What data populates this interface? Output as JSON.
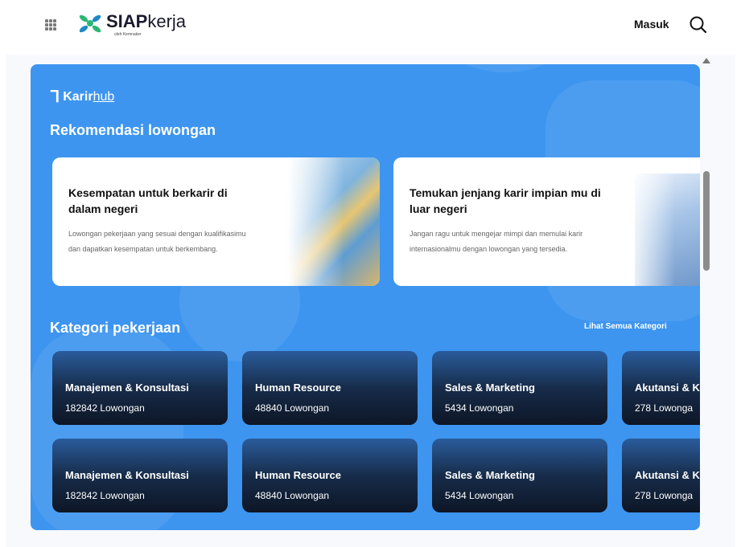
{
  "header": {
    "logo_bold": "SIAP",
    "logo_light": "kerja",
    "logo_sub": "oleh Kemnaker",
    "login_label": "Masuk",
    "search_icon": "search-icon",
    "apps_icon": "grid-icon"
  },
  "brand": {
    "bold": "Karir",
    "underline": "hub"
  },
  "recommendations": {
    "title": "Rekomendasi lowongan",
    "cards": [
      {
        "title": "Kesempatan untuk berkarir di dalam negeri",
        "desc": "Lowongan pekerjaan yang sesuai dengan kualifikasimu dan dapatkan kesempatan untuk berkembang."
      },
      {
        "title": "Temukan jenjang karir impian mu di luar negeri",
        "desc": "Jangan ragu untuk mengejar mimpi dan memulai karir internasionalmu dengan lowongan yang tersedia."
      }
    ]
  },
  "categories": {
    "title": "Kategori pekerjaan",
    "see_all": "Lihat Semua Kategori",
    "rows": [
      [
        {
          "name": "Manajemen & Konsultasi",
          "count": "182842 Lowongan"
        },
        {
          "name": "Human Resource",
          "count": "48840 Lowongan"
        },
        {
          "name": "Sales & Marketing",
          "count": "5434 Lowongan"
        },
        {
          "name": "Akutansi & K",
          "count": "278 Lowonga"
        }
      ],
      [
        {
          "name": "Manajemen & Konsultasi",
          "count": "182842 Lowongan"
        },
        {
          "name": "Human Resource",
          "count": "48840 Lowongan"
        },
        {
          "name": "Sales & Marketing",
          "count": "5434 Lowongan"
        },
        {
          "name": "Akutansi & K",
          "count": "278 Lowonga"
        }
      ]
    ]
  },
  "colors": {
    "panel": "#3d95ef",
    "card_dark": "#0d1626",
    "logo_green": "#2bb673"
  }
}
